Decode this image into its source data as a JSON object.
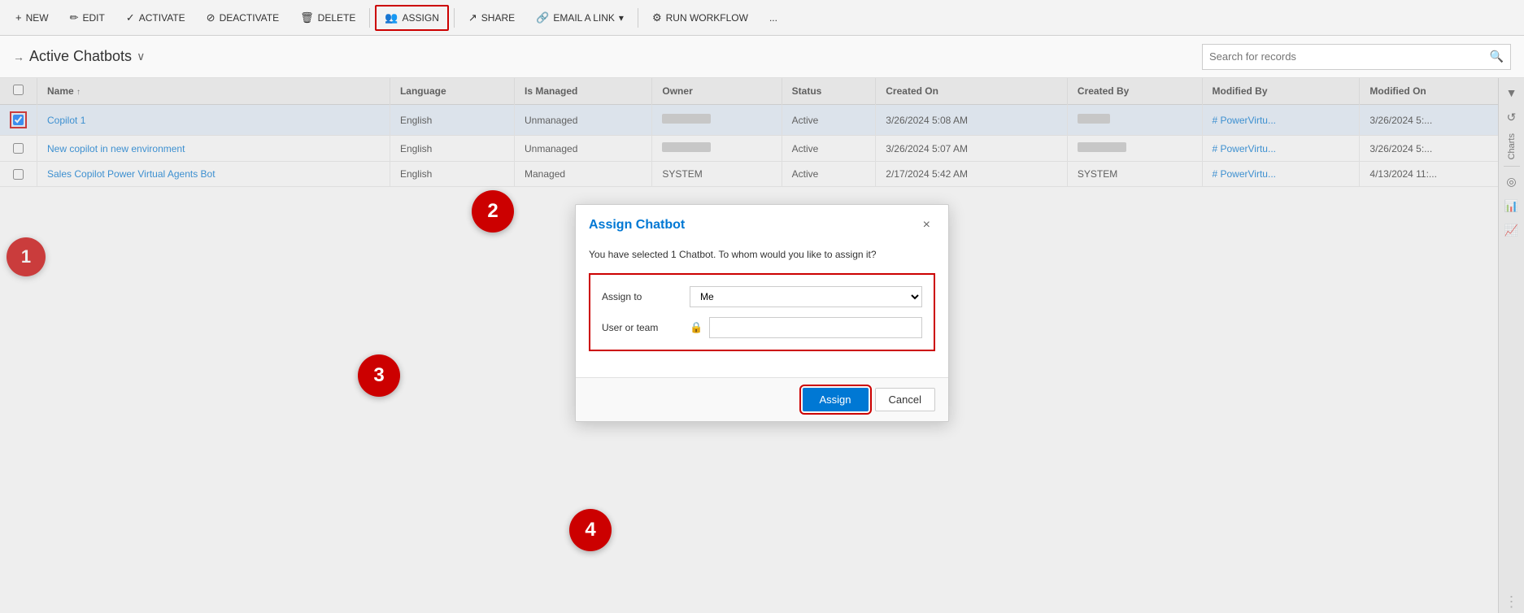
{
  "toolbar": {
    "buttons": [
      {
        "id": "new",
        "label": "NEW",
        "icon": "+"
      },
      {
        "id": "edit",
        "label": "EDIT",
        "icon": "✏"
      },
      {
        "id": "activate",
        "label": "ACTIVATE",
        "icon": "✓"
      },
      {
        "id": "deactivate",
        "label": "DEACTIVATE",
        "icon": "⊘"
      },
      {
        "id": "delete",
        "label": "DELETE",
        "icon": "🗑"
      },
      {
        "id": "assign",
        "label": "ASSIGN",
        "icon": "👥",
        "active": true
      },
      {
        "id": "share",
        "label": "SHARE",
        "icon": "↗"
      },
      {
        "id": "email",
        "label": "EMAIL A LINK",
        "icon": "🔗"
      },
      {
        "id": "workflow",
        "label": "RUN WORKFLOW",
        "icon": "⚙"
      },
      {
        "id": "more",
        "label": "...",
        "icon": ""
      }
    ]
  },
  "view": {
    "title": "Active Chatbots",
    "title_arrow": "→",
    "title_chevron": "∨"
  },
  "search": {
    "placeholder": "Search for records"
  },
  "table": {
    "columns": [
      "",
      "Name ↑",
      "Language",
      "Is Managed",
      "Owner",
      "Status",
      "Created On",
      "Created By",
      "Modified By",
      "Modified On"
    ],
    "rows": [
      {
        "checked": true,
        "name": "Copilot 1",
        "language": "English",
        "is_managed": "Unmanaged",
        "owner": "blurred",
        "status": "Active",
        "created_on": "3/26/2024 5:08 AM",
        "created_by": "blurred_sm",
        "modified_by": "# PowerVirtu...",
        "modified_on": "3/26/2024 5:..."
      },
      {
        "checked": false,
        "name": "New copilot in new environment",
        "language": "English",
        "is_managed": "Unmanaged",
        "owner": "blurred",
        "status": "Active",
        "created_on": "3/26/2024 5:07 AM",
        "created_by": "blurred",
        "modified_by": "# PowerVirtu...",
        "modified_on": "3/26/2024 5:..."
      },
      {
        "checked": false,
        "name": "Sales Copilot Power Virtual Agents Bot",
        "language": "English",
        "is_managed": "Managed",
        "owner": "SYSTEM",
        "status": "Active",
        "created_on": "2/17/2024 5:42 AM",
        "created_by": "SYSTEM",
        "modified_by": "# PowerVirtu...",
        "modified_on": "4/13/2024 11:..."
      }
    ]
  },
  "modal": {
    "title": "Assign Chatbot",
    "subtitle": "You have selected 1 Chatbot. To whom would you like to assign it?",
    "assign_to_label": "Assign to",
    "assign_to_value": "Me",
    "user_or_team_label": "User or team",
    "user_or_team_placeholder": "",
    "assign_btn": "Assign",
    "cancel_btn": "Cancel",
    "close_icon": "×"
  },
  "steps": {
    "step1": "1",
    "step2": "2",
    "step3": "3",
    "step4": "4"
  },
  "right_panel": {
    "icons": [
      "▼",
      "◎",
      "📊",
      "📈"
    ]
  }
}
